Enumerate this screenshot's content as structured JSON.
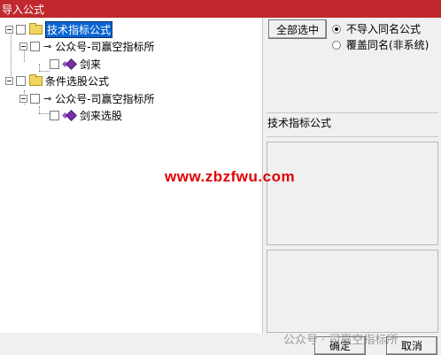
{
  "window": {
    "title": "导入公式"
  },
  "tree": {
    "nodes": [
      {
        "label": "技术指标公式"
      },
      {
        "label": "公众号-司赢空指标所"
      },
      {
        "label": "剑来"
      },
      {
        "label": "条件选股公式"
      },
      {
        "label": "公众号-司赢空指标所"
      },
      {
        "label": "剑来选股"
      }
    ]
  },
  "controls": {
    "select_all_label": "全部选中",
    "radio_options": [
      {
        "label": "不导入同名公式",
        "checked": true
      },
      {
        "label": "覆盖同名(非系统)",
        "checked": false
      }
    ],
    "info_title": "技术指标公式"
  },
  "watermark": {
    "url": "www.zbzfwu.com",
    "wechat_label": "公众号 · 司赢空指标所"
  },
  "footer": {
    "ok_label": "确定",
    "cancel_label": "取消"
  }
}
